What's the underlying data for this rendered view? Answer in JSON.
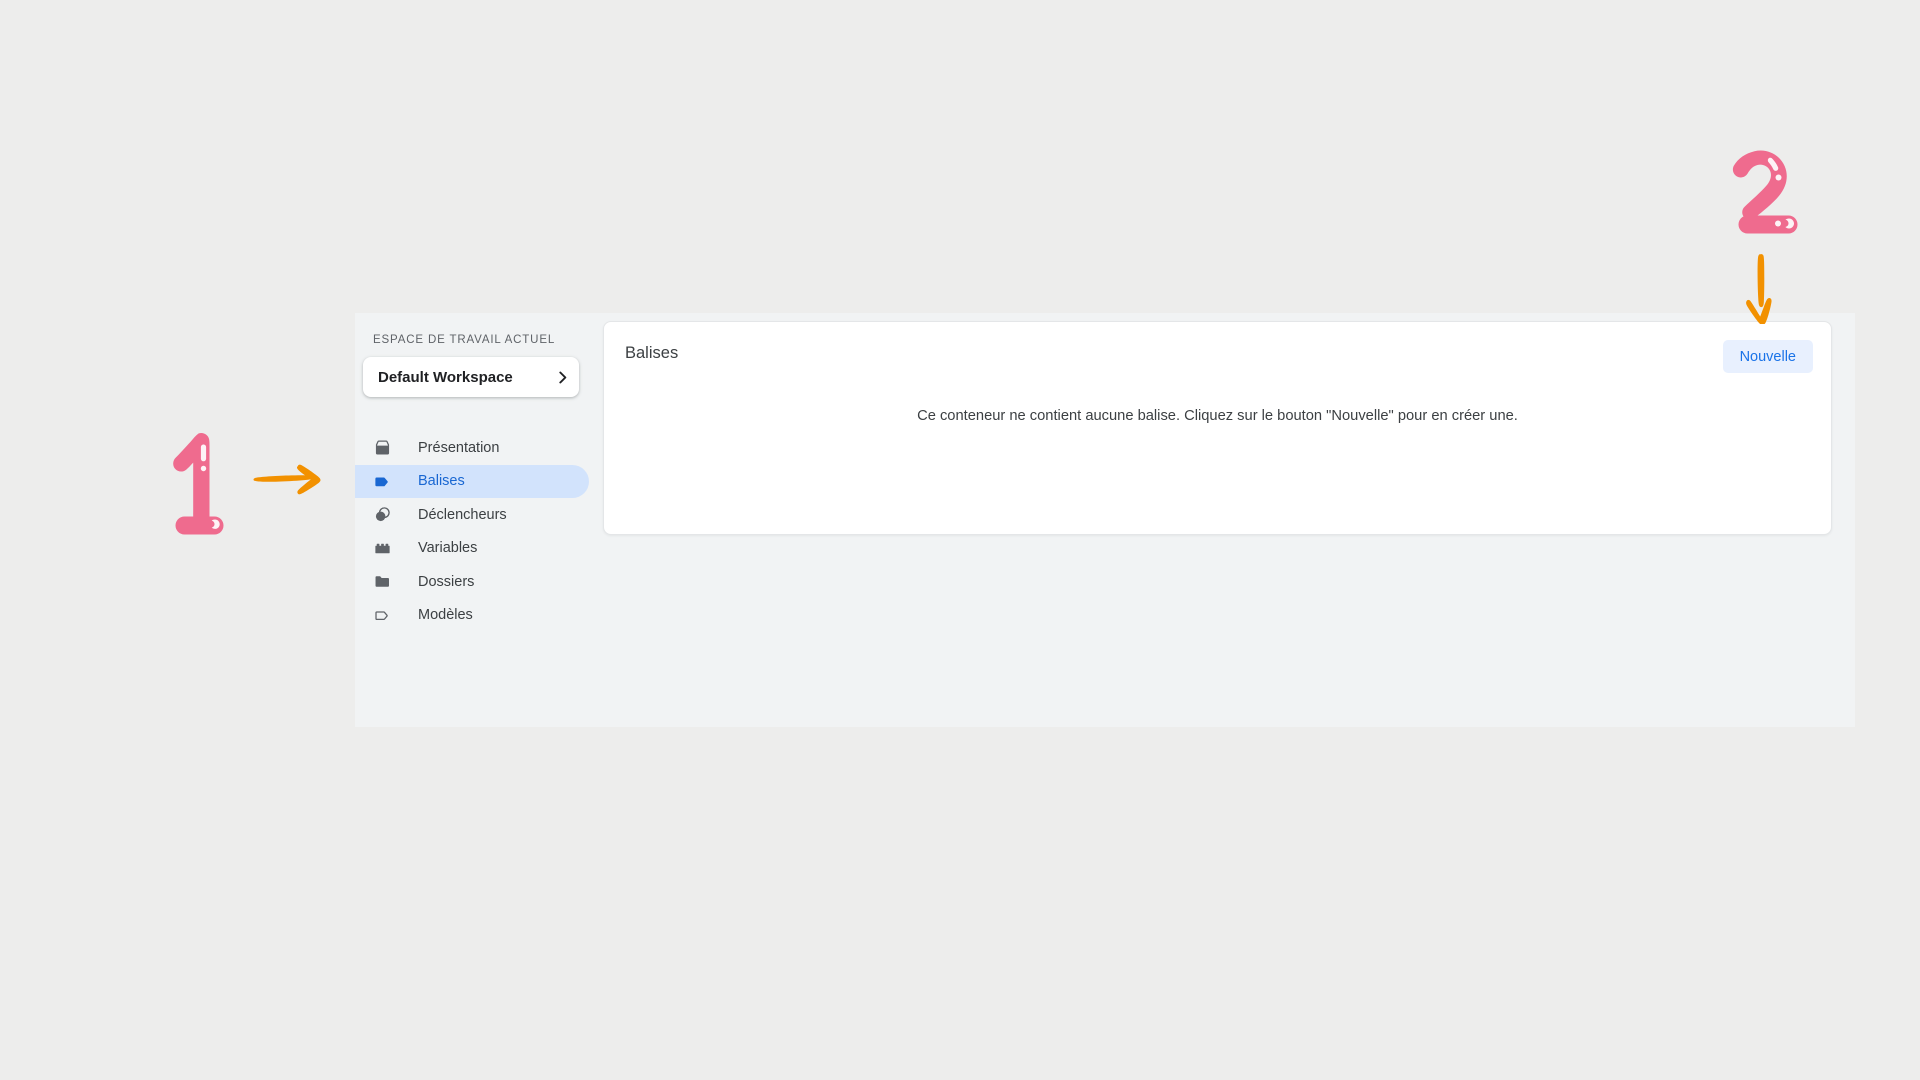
{
  "sidebar": {
    "workspace_label": "ESPACE DE TRAVAIL ACTUEL",
    "workspace_name": "Default Workspace",
    "chevron_icon": "chevron-right-icon",
    "items": [
      {
        "label": "Présentation",
        "icon": "inbox-icon",
        "active": false
      },
      {
        "label": "Balises",
        "icon": "tag-filled-icon",
        "active": true
      },
      {
        "label": "Déclencheurs",
        "icon": "overlapping-circles-icon",
        "active": false
      },
      {
        "label": "Variables",
        "icon": "brick-icon",
        "active": false
      },
      {
        "label": "Dossiers",
        "icon": "folder-icon",
        "active": false
      },
      {
        "label": "Modèles",
        "icon": "tag-outline-icon",
        "active": false
      }
    ]
  },
  "main": {
    "title": "Balises",
    "new_button_label": "Nouvelle",
    "empty_message": "Ce conteneur ne contient aucune balise. Cliquez sur le bouton \"Nouvelle\" pour en créer une."
  },
  "annotations": [
    {
      "name": "step-1-number",
      "text": "1",
      "color": "#ef6b8e"
    },
    {
      "name": "step-1-arrow",
      "direction": "right",
      "color": "#f29100"
    },
    {
      "name": "step-2-number",
      "text": "2",
      "color": "#ef6b8e"
    },
    {
      "name": "step-2-arrow",
      "direction": "down",
      "color": "#f29100"
    }
  ],
  "colors": {
    "page_background": "#ededec",
    "panel_background": "#f1f3f4",
    "card_background": "#ffffff",
    "accent_blue": "#1a73e8",
    "active_pill": "#d2e3fc",
    "button_background": "#e8f0fe",
    "annotation_pink": "#ef6b8e",
    "annotation_orange": "#f29100"
  }
}
